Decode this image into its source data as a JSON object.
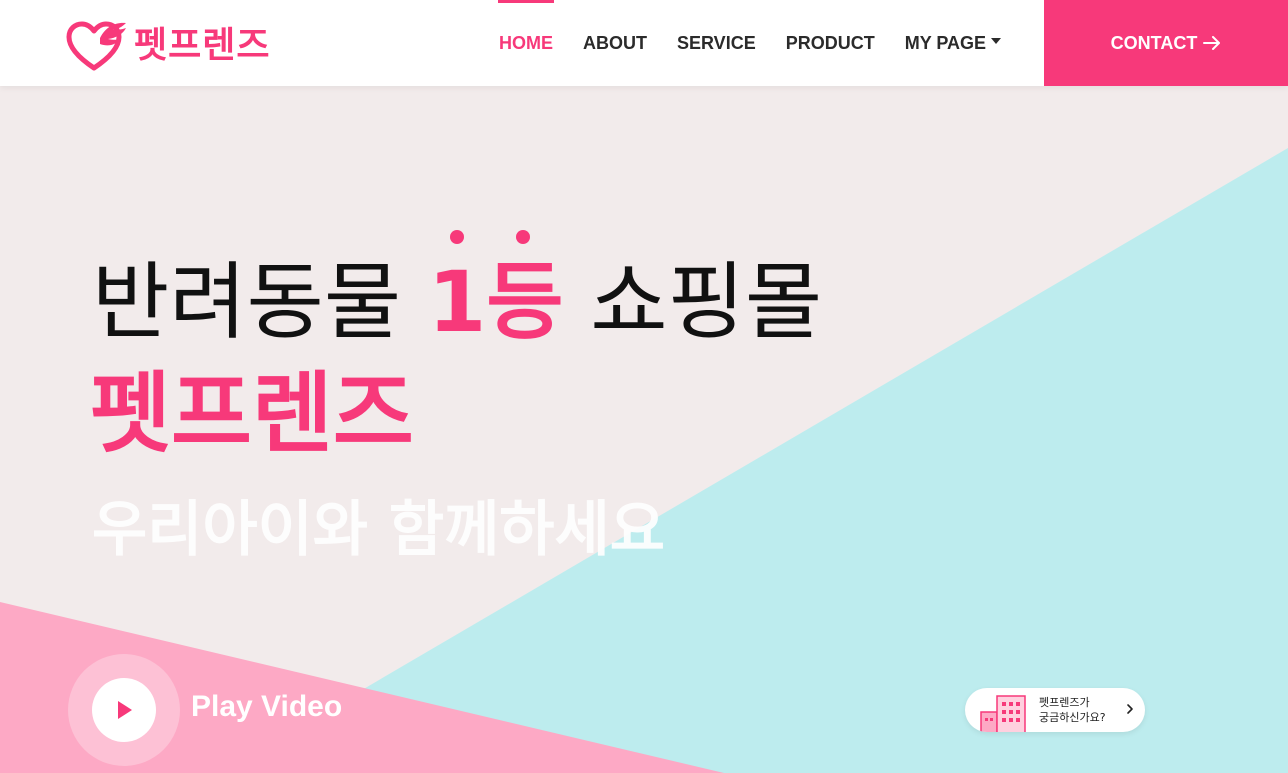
{
  "brand": {
    "name": "펫프렌즈",
    "logo_icon": "heart-wing-icon",
    "accent_color": "#f7397a"
  },
  "nav": {
    "items": [
      {
        "label": "HOME",
        "active": true
      },
      {
        "label": "ABOUT",
        "active": false
      },
      {
        "label": "SERVICE",
        "active": false
      },
      {
        "label": "PRODUCT",
        "active": false
      },
      {
        "label": "MY PAGE",
        "active": false,
        "dropdown": true
      }
    ],
    "contact_label": "CONTACT",
    "contact_icon": "arrow-right-icon"
  },
  "hero": {
    "line1_prefix": "반려동물 ",
    "line1_accent": "1등",
    "line1_suffix": " 쇼핑몰",
    "line2": "펫프렌즈",
    "line3": "우리아이와 함께하세요",
    "colors": {
      "background": "#f2ebeb",
      "teal": "#bdecee",
      "pink": "#fda9c5"
    }
  },
  "video": {
    "label": "Play Video",
    "icon": "play-icon"
  },
  "help_widget": {
    "line1": "펫프렌즈가",
    "line2": "궁금하신가요?",
    "icon": "building-icon",
    "chevron": "chevron-right-icon"
  }
}
